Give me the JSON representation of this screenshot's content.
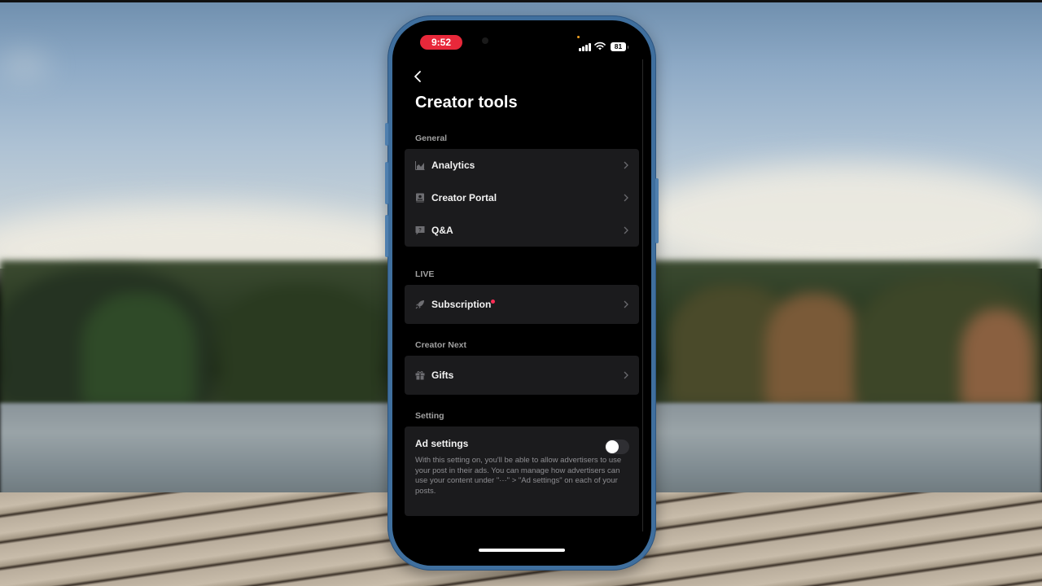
{
  "status_bar": {
    "time": "9:52",
    "battery": "81",
    "time_pill_color": "#e8283a"
  },
  "header": {
    "back_icon": "chevron-left-icon",
    "title": "Creator tools"
  },
  "sections": [
    {
      "label": "General",
      "items": [
        {
          "label": "Analytics",
          "icon": "bar-chart-icon"
        },
        {
          "label": "Creator Portal",
          "icon": "book-icon"
        },
        {
          "label": "Q&A",
          "icon": "question-chat-icon"
        }
      ]
    },
    {
      "label": "LIVE",
      "items": [
        {
          "label": "Subscription",
          "icon": "rocket-icon",
          "has_badge": true
        }
      ]
    },
    {
      "label": "Creator Next",
      "items": [
        {
          "label": "Gifts",
          "icon": "gift-icon"
        }
      ]
    },
    {
      "label": "Setting",
      "ad_settings": {
        "title": "Ad settings",
        "enabled": false,
        "description": "With this setting on, you'll be able to allow advertisers to use your post in their ads. You can manage how advertisers can use your content under \"···\" > \"Ad settings\" on each of your posts."
      }
    }
  ],
  "colors": {
    "badge": "#fe2c55",
    "card_bg": "#1b1b1d",
    "screen_bg": "#000000",
    "phone_frame": "#3f6f9e"
  }
}
